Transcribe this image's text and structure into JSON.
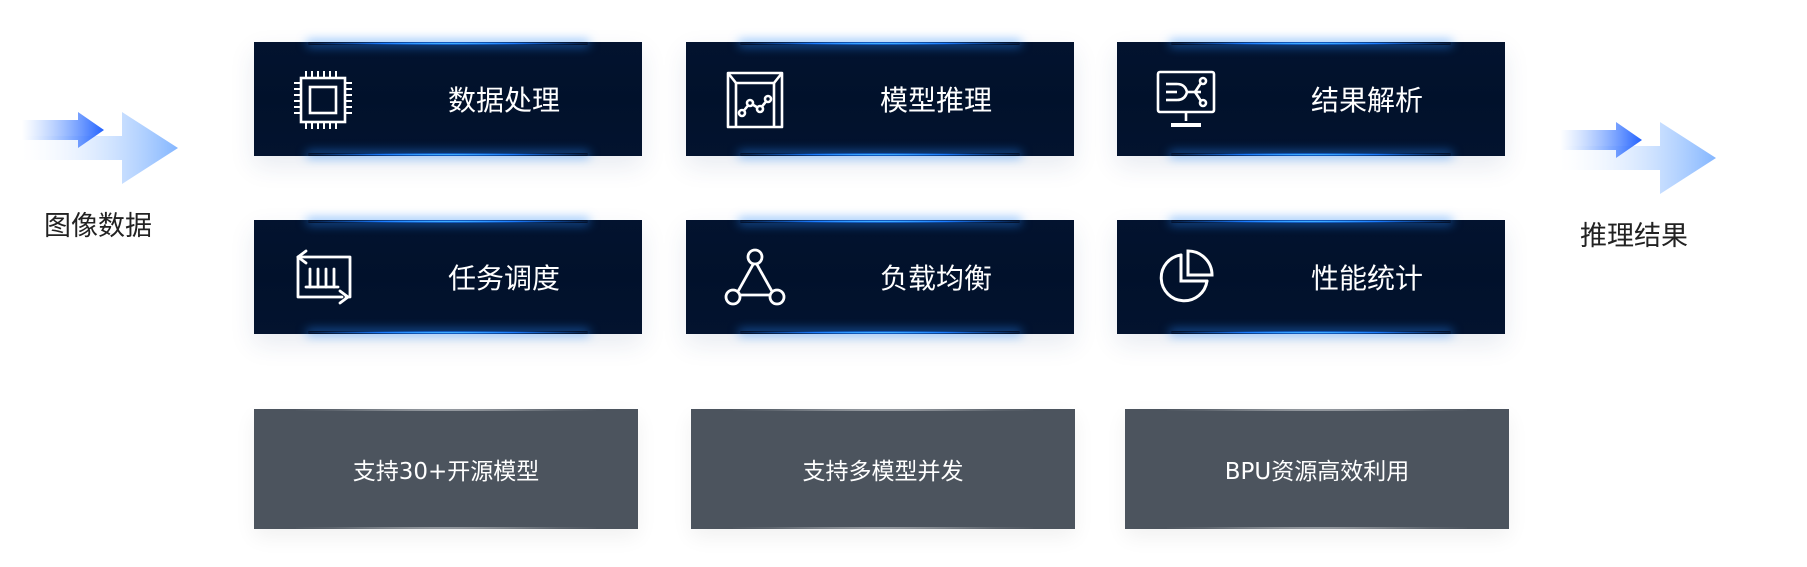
{
  "input": {
    "label": "图像数据"
  },
  "output": {
    "label": "推理结果"
  },
  "modules": [
    {
      "label": "数据处理",
      "icon": "chip-icon"
    },
    {
      "label": "模型推理",
      "icon": "model-box-icon"
    },
    {
      "label": "结果解析",
      "icon": "monitor-analysis-icon"
    },
    {
      "label": "任务调度",
      "icon": "schedule-icon"
    },
    {
      "label": "负载均衡",
      "icon": "network-triangle-icon"
    },
    {
      "label": "性能统计",
      "icon": "pie-chart-icon"
    }
  ],
  "features": [
    {
      "label": "支持30+开源模型"
    },
    {
      "label": "支持多模型并发"
    },
    {
      "label": "BPU资源高效利用"
    }
  ],
  "colors": {
    "card_bg": "#01112b",
    "card_glow": "#1a7bff",
    "feature_bg": "#4c545e",
    "arrow_blue": "#2f6bff"
  }
}
